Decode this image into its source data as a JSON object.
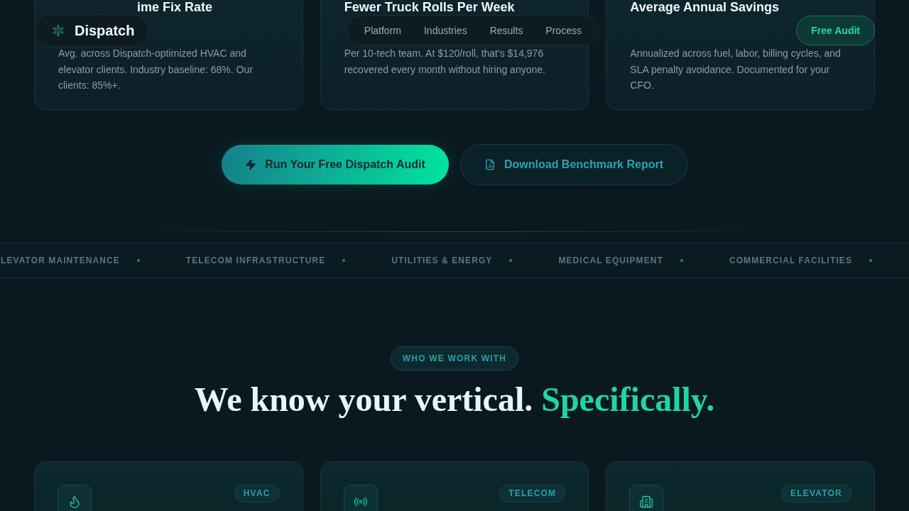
{
  "nav": {
    "brand": "Dispatch",
    "links": [
      {
        "label": "Platform"
      },
      {
        "label": "Industries"
      },
      {
        "label": "Results"
      },
      {
        "label": "Process"
      }
    ],
    "cta": "Free Audit"
  },
  "stats": [
    {
      "title": "ime Fix Rate",
      "description": "Avg. across Dispatch-optimized HVAC and elevator clients. Industry baseline: 68%. Our clients: 85%+."
    },
    {
      "title": "Fewer Truck Rolls Per Week",
      "description": "Per 10-tech team. At $120/roll, that's $14,976 recovered every month without hiring anyone."
    },
    {
      "title": "Average Annual Savings",
      "description": "Annualized across fuel, labor, billing cycles, and SLA penalty avoidance. Documented for your CFO."
    }
  ],
  "actions": [
    {
      "kind": "primary",
      "label": "Run Your Free Dispatch Audit"
    },
    {
      "kind": "secondary",
      "label": "Download Benchmark Report"
    }
  ],
  "industries_ticker": [
    "LEVATOR MAINTENANCE",
    "TELECOM INFRASTRUCTURE",
    "UTILITIES & ENERGY",
    "MEDICAL EQUIPMENT",
    "COMMERCIAL FACILITIES"
  ],
  "section": {
    "eyebrow": "WHO WE WORK WITH",
    "heading": "We know your vertical.",
    "heading_accent": "Specifically."
  },
  "verticals": [
    {
      "tag": "HVAC"
    },
    {
      "tag": "TELECOM"
    },
    {
      "tag": "ELEVATOR"
    }
  ]
}
